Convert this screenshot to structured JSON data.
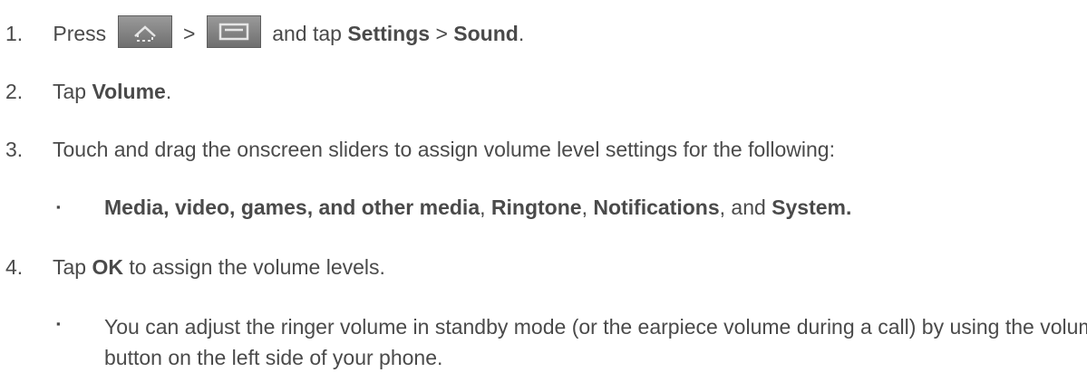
{
  "steps": [
    {
      "number": "1.",
      "press": "Press",
      "sep": ">",
      "tail": "and tap",
      "settings": "Settings",
      "arrow": ">",
      "sound": "Sound",
      "end": ".",
      "icons": [
        "home-icon",
        "menu-icon"
      ]
    },
    {
      "number": "2.",
      "pre": "Tap",
      "bold": "Volume",
      "end": "."
    },
    {
      "number": "3.",
      "text": "Touch and drag the onscreen sliders to assign volume level settings for the following:",
      "bullet": {
        "glyph": "▪",
        "b1": "Media, video, games, and other media",
        "c1": ",",
        "b2": "Ringtone",
        "c2": ",",
        "b3": "Notifications",
        "c3": ", and",
        "b4": "System."
      }
    },
    {
      "number": "4.",
      "pre": "Tap",
      "bold": "OK",
      "post": "to assign the volume levels.",
      "bullet": {
        "glyph": "▪",
        "text": "You can adjust the ringer volume in standby mode (or the earpiece volume during a call) by using the volume button on the left side of your phone."
      }
    }
  ]
}
